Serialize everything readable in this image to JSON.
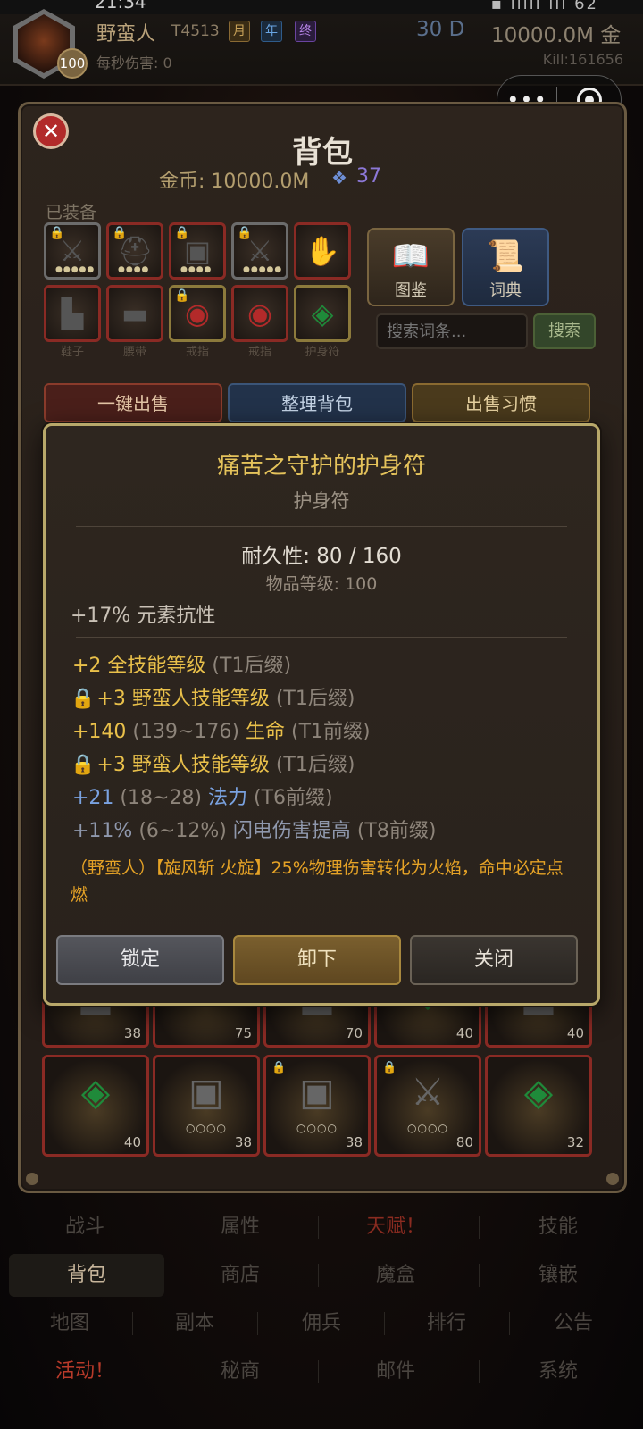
{
  "statusbar": {
    "time": "21:34",
    "icons": "⌒ ▪ ıllıl ıll 62"
  },
  "player": {
    "name": "野蛮人",
    "tier": "T4513",
    "tag_month": "月",
    "tag_year": "年",
    "tag_final": "终",
    "level": "100",
    "dps": "每秒伤害: 0",
    "days": "30 D",
    "gold": "10000.0M 金",
    "kills": "Kill:161656"
  },
  "capsule": {
    "menu_glyph": "•••"
  },
  "bag": {
    "title": "背包",
    "gold": "金币: 10000.0M",
    "gem_icon": "❖",
    "gems": "37",
    "equipped_label": "已装备",
    "equip_labels": [
      "鞋子",
      "腰带",
      "戒指",
      "戒指",
      "护身符"
    ],
    "codex_label": "图鉴",
    "dict_label": "词典",
    "search_placeholder": "搜索词条...",
    "search_btn": "搜索",
    "btn_sell_all": "一键出售",
    "btn_sort": "整理背包",
    "btn_sell_habit": "出售习惯",
    "items_row1": [
      "38",
      "75",
      "70",
      "40",
      "40"
    ],
    "items_row2": [
      "40",
      "38",
      "38",
      "80",
      "32"
    ]
  },
  "tooltip": {
    "name": "痛苦之守护的护身符",
    "type": "护身符",
    "durability": "耐久性: 80 / 160",
    "item_level": "物品等级: 100",
    "implicit": "+17% 元素抗性",
    "mods": [
      {
        "lock": "",
        "main": "+2 全技能等级",
        "range": "",
        "name": "",
        "tier": " (T1后缀)"
      },
      {
        "lock": "🔒",
        "main": "+3 野蛮人技能等级",
        "range": "",
        "name": "",
        "tier": " (T1后缀)"
      },
      {
        "lock": "",
        "main": "+140",
        "range": " (139~176) ",
        "name": "生命",
        "tier": " (T1前缀)"
      },
      {
        "lock": "🔒",
        "main": "+3 野蛮人技能等级",
        "range": "",
        "name": "",
        "tier": " (T1后缀)"
      },
      {
        "lock": "",
        "main": "+21",
        "range": " (18~28) ",
        "name": "法力",
        "tier": " (T6前缀)"
      },
      {
        "lock": "",
        "main": "+11%",
        "range": " (6~12%) ",
        "name": "闪电伤害提高",
        "tier": " (T8前缀)"
      }
    ],
    "special": "（野蛮人）【旋风斩 火旋】25%物理伤害转化为火焰，命中必定点燃",
    "btn_lock": "锁定",
    "btn_unequip": "卸下",
    "btn_close": "关闭"
  },
  "nav": {
    "row1": [
      "战斗",
      "属性",
      "天赋！",
      "技能"
    ],
    "row2": [
      "背包",
      "商店",
      "魔盒",
      "镶嵌"
    ],
    "row3": [
      "地图",
      "副本",
      "佣兵",
      "排行",
      "公告"
    ],
    "row4": [
      "活动！",
      "秘商",
      "邮件",
      "系统"
    ]
  }
}
